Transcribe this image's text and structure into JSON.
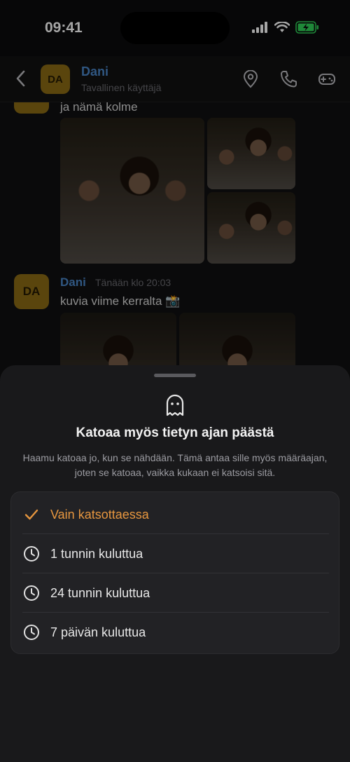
{
  "status_bar": {
    "time": "09:41"
  },
  "header": {
    "avatar_initials": "DA",
    "name": "Dani",
    "subtitle": "Tavallinen käyttäjä"
  },
  "chat": {
    "msg1_text": "ja nämä kolme",
    "msg2": {
      "avatar_initials": "DA",
      "sender": "Dani",
      "time": "Tänään klo 20:03",
      "text": "kuvia viime kerralta 📸"
    }
  },
  "sheet": {
    "title": "Katoaa myös tietyn ajan päästä",
    "description": "Haamu katoaa jo, kun se nähdään. Tämä antaa sille myös määräajan, joten se katoaa, vaikka kukaan ei katsoisi sitä.",
    "options": [
      {
        "label": "Vain katsottaessa",
        "icon": "checkmark-icon",
        "selected": true
      },
      {
        "label": "1 tunnin kuluttua",
        "icon": "clock-icon",
        "selected": false
      },
      {
        "label": "24 tunnin kuluttua",
        "icon": "clock-icon",
        "selected": false
      },
      {
        "label": "7 päivän kuluttua",
        "icon": "clock-icon",
        "selected": false
      }
    ]
  },
  "colors": {
    "accent": "#e6963f",
    "name": "#4a86c8",
    "avatar": "#8a6a15",
    "battery": "#30d158"
  }
}
